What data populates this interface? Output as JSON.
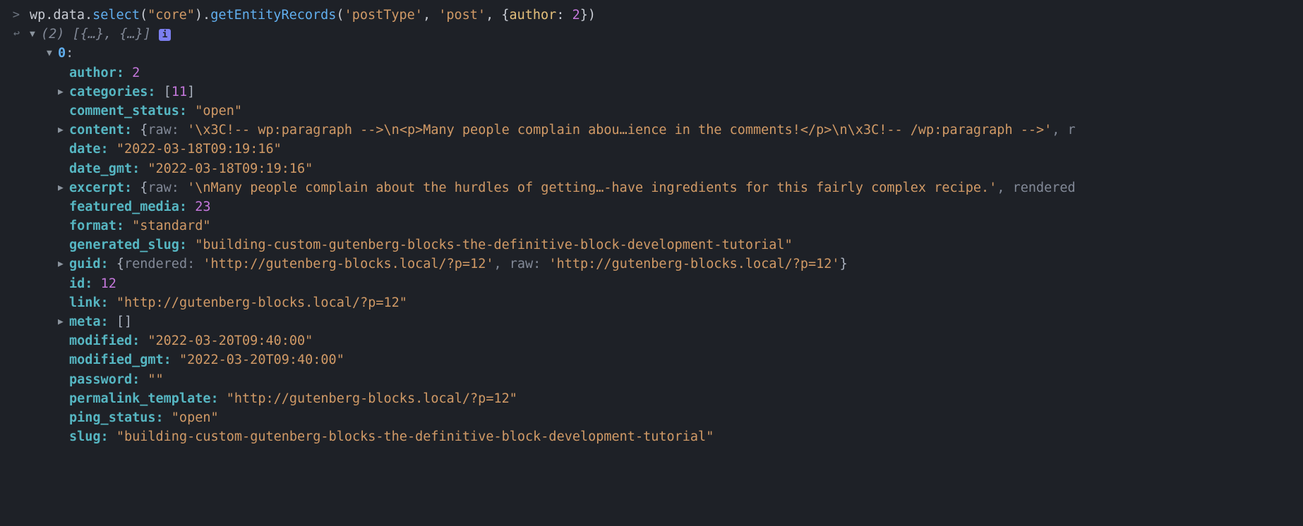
{
  "input": {
    "prompt": ">",
    "code_parts": {
      "p1": "wp",
      "p2": ".",
      "p3": "data",
      "p4": ".",
      "p5": "select",
      "p6": "(",
      "p7": "\"core\"",
      "p8": ").",
      "p9": "getEntityRecords",
      "p10": "(",
      "p11": "'postType'",
      "p12": ", ",
      "p13": "'post'",
      "p14": ", {",
      "p15": "author",
      "p16": ": ",
      "p17": "2",
      "p18": "})"
    }
  },
  "result_header": {
    "count": "(2)",
    "preview": "[{…}, {…}]",
    "badge": "i"
  },
  "entry": {
    "index": "0",
    "author_k": "author:",
    "author_v": "2",
    "categories_k": "categories:",
    "categories_open": "[",
    "categories_v": "11",
    "categories_close": "]",
    "comment_status_k": "comment_status:",
    "comment_status_v": "\"open\"",
    "content_k": "content:",
    "content_open": "{",
    "content_raw_k": "raw:",
    "content_raw_v": "'\\x3C!-- wp:paragraph -->\\n<p>Many people complain abou…ience in the comments!</p>\\n\\x3C!-- /wp:paragraph -->'",
    "content_trail": ", r",
    "date_k": "date:",
    "date_v": "\"2022-03-18T09:19:16\"",
    "date_gmt_k": "date_gmt:",
    "date_gmt_v": "\"2022-03-18T09:19:16\"",
    "excerpt_k": "excerpt:",
    "excerpt_open": "{",
    "excerpt_raw_k": "raw:",
    "excerpt_raw_v": "'\\nMany people complain about the hurdles of getting…-have ingredients for this fairly complex recipe.'",
    "excerpt_trail": ", rendered",
    "featured_media_k": "featured_media:",
    "featured_media_v": "23",
    "format_k": "format:",
    "format_v": "\"standard\"",
    "generated_slug_k": "generated_slug:",
    "generated_slug_v": "\"building-custom-gutenberg-blocks-the-definitive-block-development-tutorial\"",
    "guid_k": "guid:",
    "guid_open": "{",
    "guid_rendered_k": "rendered:",
    "guid_rendered_v": "'http://gutenberg-blocks.local/?p=12'",
    "guid_sep": ", ",
    "guid_raw_k": "raw:",
    "guid_raw_v": "'http://gutenberg-blocks.local/?p=12'",
    "guid_close": "}",
    "id_k": "id:",
    "id_v": "12",
    "link_k": "link:",
    "link_v": "\"http://gutenberg-blocks.local/?p=12\"",
    "meta_k": "meta:",
    "meta_v": "[]",
    "modified_k": "modified:",
    "modified_v": "\"2022-03-20T09:40:00\"",
    "modified_gmt_k": "modified_gmt:",
    "modified_gmt_v": "\"2022-03-20T09:40:00\"",
    "password_k": "password:",
    "password_v": "\"\"",
    "permalink_template_k": "permalink_template:",
    "permalink_template_v": "\"http://gutenberg-blocks.local/?p=12\"",
    "ping_status_k": "ping_status:",
    "ping_status_v": "\"open\"",
    "slug_k": "slug:",
    "slug_v": "\"building-custom-gutenberg-blocks-the-definitive-block-development-tutorial\""
  }
}
